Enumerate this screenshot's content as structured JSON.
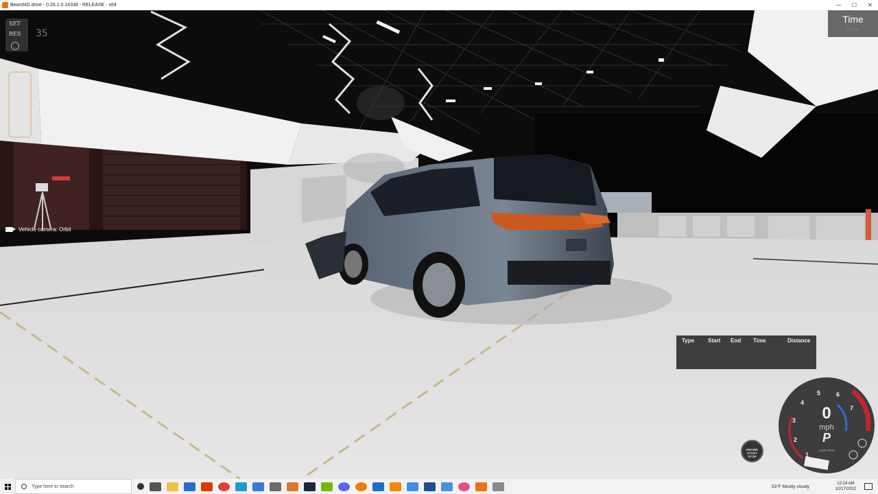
{
  "window": {
    "title": "BeamNG.drive - 0.26.1.0.14338 - RELEASE - x64",
    "controls": [
      "—",
      "☐",
      "✕"
    ]
  },
  "hud": {
    "set_label": "SET",
    "res_label": "RES",
    "speed_limit": "35",
    "camera_label": "Vehicle camera: Orbit",
    "time_title": "Time",
    "time_value": "-:-:-"
  },
  "timing_table": {
    "columns": [
      "Type",
      "Start",
      "End",
      "Time",
      "Distance"
    ],
    "rows": []
  },
  "gauge": {
    "speed": "0",
    "unit": "mph",
    "gear": "P",
    "rpm_label": "x1000 RPM",
    "ticks": [
      "1",
      "2",
      "3",
      "4",
      "5",
      "6",
      "7"
    ],
    "redline_color": "#c0272d",
    "accent_color": "#2d6fd6"
  },
  "start_stop": {
    "line1": "ENGINE",
    "line2": "START",
    "line3": "STOP"
  },
  "taskbar": {
    "search_placeholder": "Type here to search",
    "weather": "53°F  Mostly cloudy",
    "time": "12:24 AM",
    "date": "10/17/2022",
    "app_icons": [
      "task-view",
      "widgets",
      "file-explorer",
      "mail",
      "office",
      "chrome",
      "edge",
      "store",
      "notepad",
      "photos",
      "steam",
      "nvidia",
      "discord",
      "blender",
      "malwarebytes",
      "vlc",
      "calendar",
      "obs",
      "photoshop",
      "camera",
      "beamng",
      "paint"
    ]
  }
}
